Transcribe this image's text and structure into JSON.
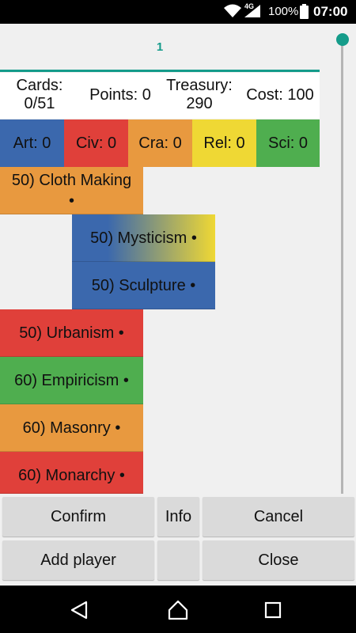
{
  "status_bar": {
    "network": "4G",
    "battery": "100%",
    "time": "07:00"
  },
  "tab": {
    "label": "1"
  },
  "stats": {
    "cards_label": "Cards:",
    "cards_value": "0/51",
    "points": "Points: 0",
    "treasury_label": "Treasury:",
    "treasury_value": "290",
    "cost": "Cost: 100"
  },
  "categories": [
    {
      "label": "Art: 0",
      "color": "#3b68ad"
    },
    {
      "label": "Civ: 0",
      "color": "#e0403a"
    },
    {
      "label": "Cra: 0",
      "color": "#e8993f"
    },
    {
      "label": "Rel: 0",
      "color": "#efd834"
    },
    {
      "label": "Sci: 0",
      "color": "#4fae4f"
    }
  ],
  "cards": [
    {
      "label": "50) Cloth Making",
      "dot": "•",
      "color": "#e8993f"
    },
    {
      "label": "50) Mysticism •",
      "colors": [
        "#3b68ad",
        "#efd834"
      ]
    },
    {
      "label": "50) Sculpture •",
      "color": "#3b68ad"
    },
    {
      "label": "50) Urbanism •",
      "color": "#e0403a"
    },
    {
      "label": "60) Empiricism •",
      "color": "#4fae4f"
    },
    {
      "label": "60) Masonry •",
      "color": "#e8993f"
    },
    {
      "label": "60) Monarchy •",
      "color": "#e0403a"
    }
  ],
  "buttons": {
    "confirm": "Confirm",
    "info": "Info",
    "cancel": "Cancel",
    "add_player": "Add player",
    "close": "Close"
  },
  "accent_color": "#149b8a"
}
